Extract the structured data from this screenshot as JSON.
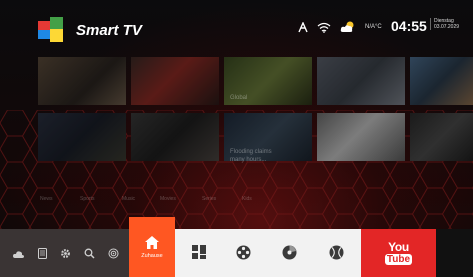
{
  "header": {
    "app_title": "Smart TV",
    "temperature": "N/A°C",
    "time": "04:55",
    "weekday": "Dienstag",
    "date": "03.07.2029",
    "status_icons": [
      "user-icon",
      "wifi-icon",
      "weather-cloud-icon"
    ]
  },
  "content": {
    "captions": [
      "Global",
      "Flooding claims",
      "many hours..."
    ],
    "categories": [
      "News",
      "Sports",
      "Music",
      "Movies",
      "Series",
      "Kids"
    ]
  },
  "dock": {
    "side_icons": [
      "cloud-icon",
      "file-icon",
      "settings-icon",
      "search-icon",
      "broadcast-icon"
    ],
    "home_label": "Zuhause",
    "apps": [
      "apps-grid-icon",
      "film-reel-icon",
      "music-disc-icon",
      "sports-ball-icon"
    ],
    "youtube": {
      "line1": "You",
      "line2": "Tube"
    }
  },
  "colors": {
    "home_tile": "#ff5722",
    "youtube": "#e32626",
    "dock": "#3a3434",
    "app_strip": "#f2f2f2"
  }
}
